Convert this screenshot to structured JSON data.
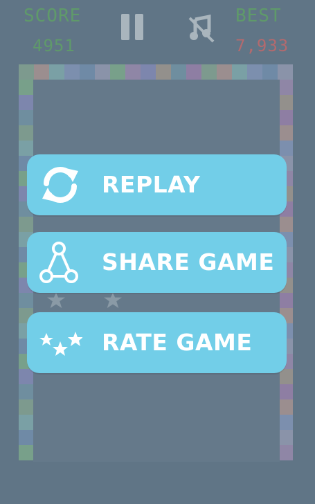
{
  "hud": {
    "score_label": "SCORE",
    "score_value": "4951",
    "best_label": "BEST",
    "best_value": "7,933"
  },
  "menu": {
    "replay_label": "REPLAY",
    "share_label": "SHARE GAME",
    "rate_label": "RATE GAME"
  },
  "colors": {
    "background": "#607586",
    "button": "#72cee8",
    "score_green": "#5f9a6a",
    "best_red": "#b36a6e"
  },
  "icons": {
    "pause": "pause-icon",
    "sound": "sound-muted-icon",
    "replay": "refresh-icon",
    "share": "share-icon",
    "rate": "stars-icon"
  }
}
